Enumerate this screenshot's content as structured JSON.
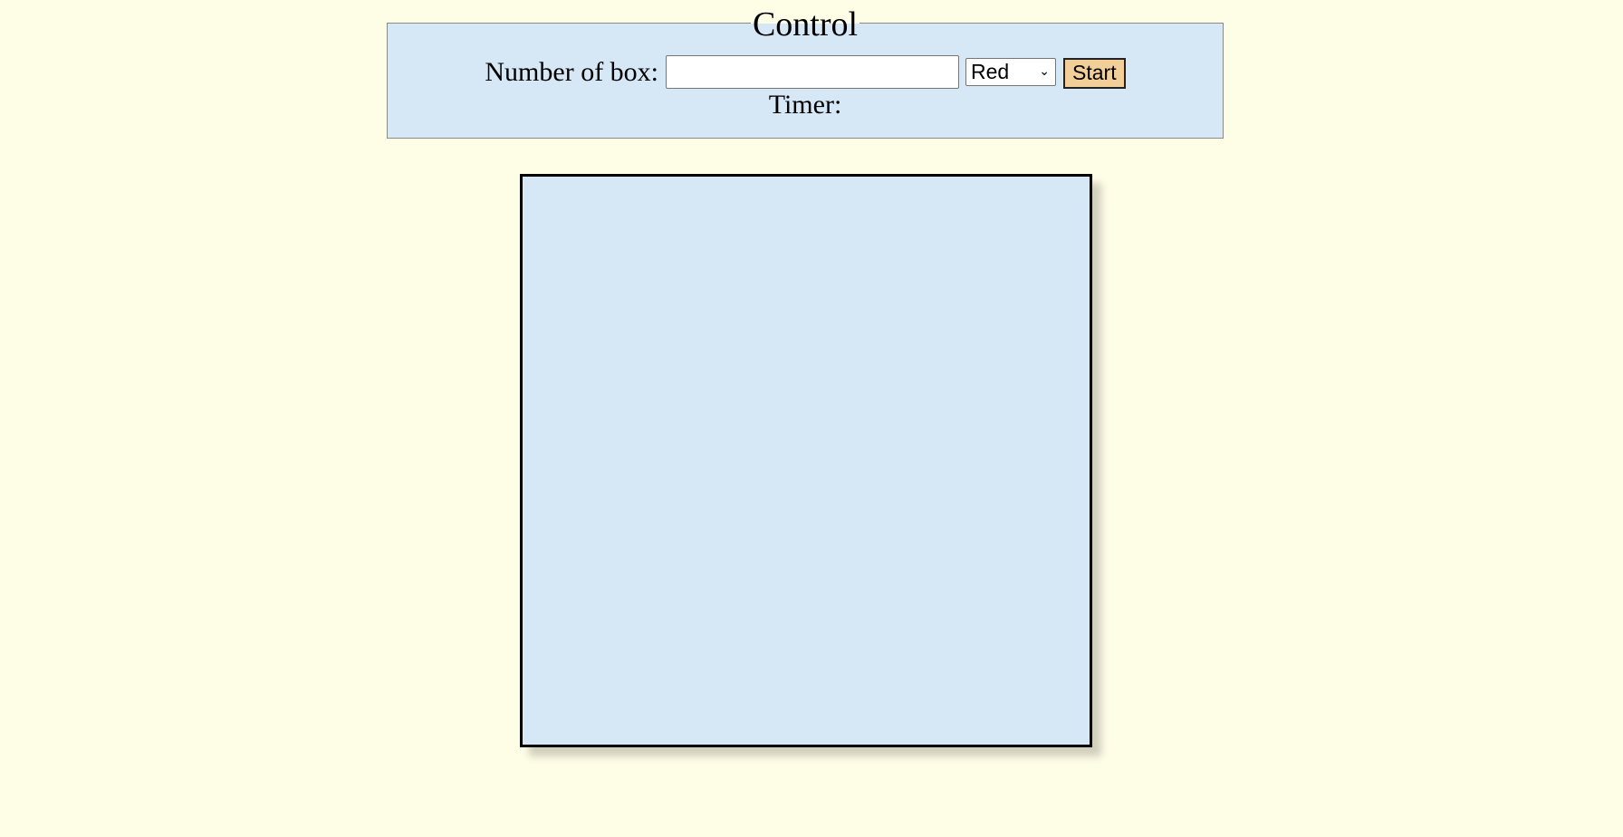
{
  "control": {
    "legend": "Control",
    "number_label": "Number of box:",
    "number_value": "",
    "color_selected": "Red",
    "start_label": "Start",
    "timer_label": "Timer:",
    "timer_value": ""
  },
  "colors": {
    "page_background": "#fefde6",
    "panel_background": "#d6e7f6",
    "start_button": "#f2ce98"
  }
}
